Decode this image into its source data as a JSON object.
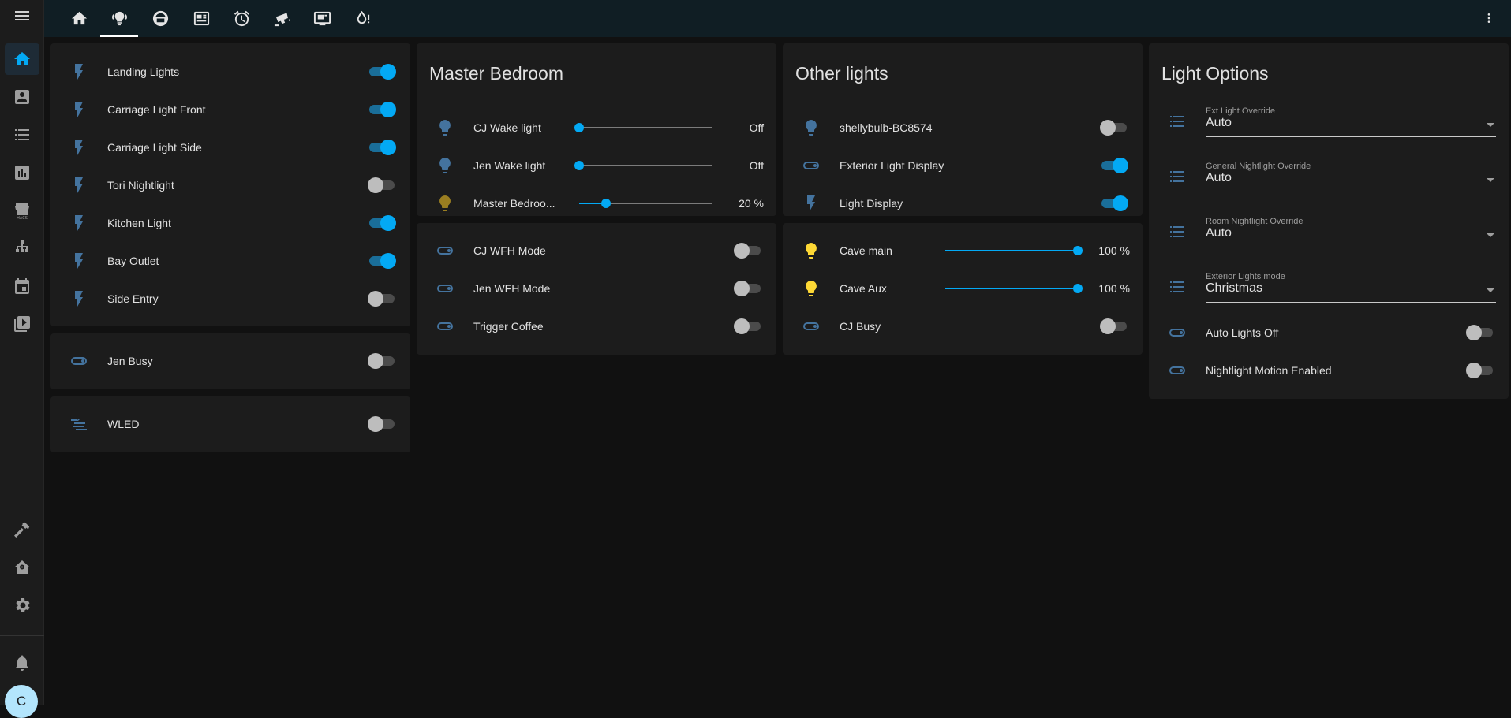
{
  "colors": {
    "accent": "#03a9f4",
    "background": "#111111",
    "card": "#1c1c1c",
    "header": "#101e24",
    "icon": "#44739e",
    "bulb_on": "#fdd835"
  },
  "sidebar": {
    "top_icons": [
      "home-icon",
      "account-box-icon",
      "list-icon",
      "chart-icon",
      "store-hacs-icon",
      "network-icon",
      "calendar-icon",
      "media-icon"
    ],
    "bottom_icons": [
      "hammer-icon",
      "home-config-icon",
      "gear-icon",
      "bell-icon"
    ],
    "avatar_initial": "C"
  },
  "topbar": {
    "tabs": [
      "home-icon",
      "lightbulb-group-icon",
      "bed-icon",
      "newspaper-icon",
      "alarm-icon",
      "cctv-icon",
      "monitor-icon",
      "water-alert-icon"
    ],
    "active_tab": 1
  },
  "cards": {
    "switches": {
      "rows": [
        {
          "label": "Landing Lights",
          "icon": "flash-icon",
          "on": true
        },
        {
          "label": "Carriage Light Front",
          "icon": "flash-icon",
          "on": true
        },
        {
          "label": "Carriage Light Side",
          "icon": "flash-icon",
          "on": true
        },
        {
          "label": "Tori Nightlight",
          "icon": "flash-icon",
          "on": false
        },
        {
          "label": "Kitchen Light",
          "icon": "flash-icon",
          "on": true
        },
        {
          "label": "Bay Outlet",
          "icon": "flash-icon",
          "on": true
        },
        {
          "label": "Side Entry",
          "icon": "flash-icon",
          "on": false
        }
      ]
    },
    "jen_busy": {
      "label": "Jen Busy",
      "icon": "toggle-switch-icon",
      "on": false
    },
    "wled": {
      "label": "WLED",
      "icon": "led-strip-icon",
      "on": false
    },
    "master_bedroom": {
      "title": "Master Bedroom",
      "rows": [
        {
          "label": "CJ Wake light",
          "value": "Off",
          "level": 0
        },
        {
          "label": "Jen Wake light",
          "value": "Off",
          "level": 0
        },
        {
          "label": "Master Bedroo...",
          "value": "20 %",
          "level": 20
        }
      ]
    },
    "modes": {
      "rows": [
        {
          "label": "CJ WFH Mode",
          "on": false
        },
        {
          "label": "Jen WFH Mode",
          "on": false
        },
        {
          "label": "Trigger Coffee",
          "on": false
        }
      ]
    },
    "other_lights": {
      "title": "Other lights",
      "rows": [
        {
          "label": "shellybulb-BC8574",
          "icon": "lightbulb-icon",
          "on": false
        },
        {
          "label": "Exterior Light Display",
          "icon": "toggle-switch-icon",
          "on": true
        },
        {
          "label": "Light Display",
          "icon": "flash-icon",
          "on": true
        }
      ]
    },
    "cave": {
      "rows": [
        {
          "label": "Cave main",
          "value": "100 %",
          "level": 100
        },
        {
          "label": "Cave Aux",
          "value": "100 %",
          "level": 100
        }
      ],
      "busy": {
        "label": "CJ Busy",
        "on": false
      }
    },
    "light_options": {
      "title": "Light Options",
      "selects": [
        {
          "label": "Ext Light Override",
          "value": "Auto"
        },
        {
          "label": "General Nightlight Override",
          "value": "Auto"
        },
        {
          "label": "Room Nightlight Override",
          "value": "Auto"
        },
        {
          "label": "Exterior Lights mode",
          "value": "Christmas"
        }
      ],
      "toggles": [
        {
          "label": "Auto Lights Off",
          "on": false
        },
        {
          "label": "Nightlight Motion Enabled",
          "on": false
        }
      ]
    }
  }
}
